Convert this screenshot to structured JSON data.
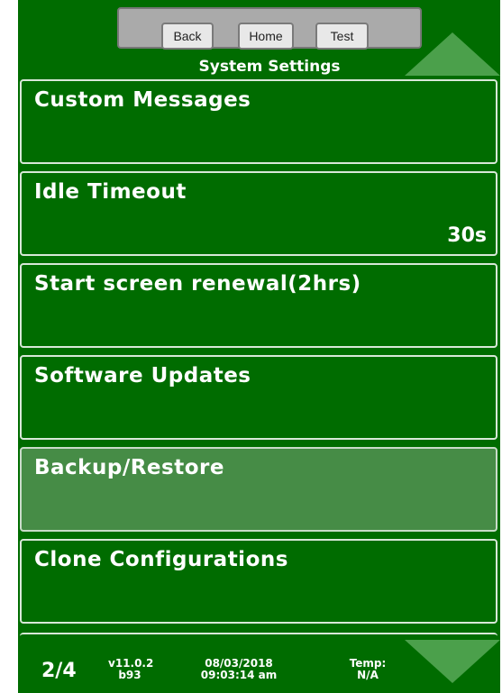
{
  "header": {
    "title": "System Settings",
    "buttons": {
      "back": "Back",
      "home": "Home",
      "test": "Test"
    }
  },
  "menu": {
    "items": [
      {
        "label": "Custom Messages",
        "value": ""
      },
      {
        "label": "Idle Timeout",
        "value": "30s"
      },
      {
        "label": "Start screen renewal(2hrs)",
        "value": ""
      },
      {
        "label": "Software Updates",
        "value": ""
      },
      {
        "label": "Backup/Restore",
        "value": "",
        "selected": true
      },
      {
        "label": "Clone Configurations",
        "value": ""
      }
    ]
  },
  "footer": {
    "page": "2/4",
    "version_line1": "v11.0.2",
    "version_line2": "b93",
    "date": "08/03/2018",
    "time": "09:03:14 am",
    "temp_label": "Temp:",
    "temp_value": "N/A"
  },
  "colors": {
    "background": "#006c00",
    "arrow": "#4ba04b",
    "selected_item": "#468c46",
    "top_bar": "#aaaaaa"
  },
  "icons": {
    "scroll_up": "triangle-up",
    "scroll_down": "triangle-down"
  }
}
